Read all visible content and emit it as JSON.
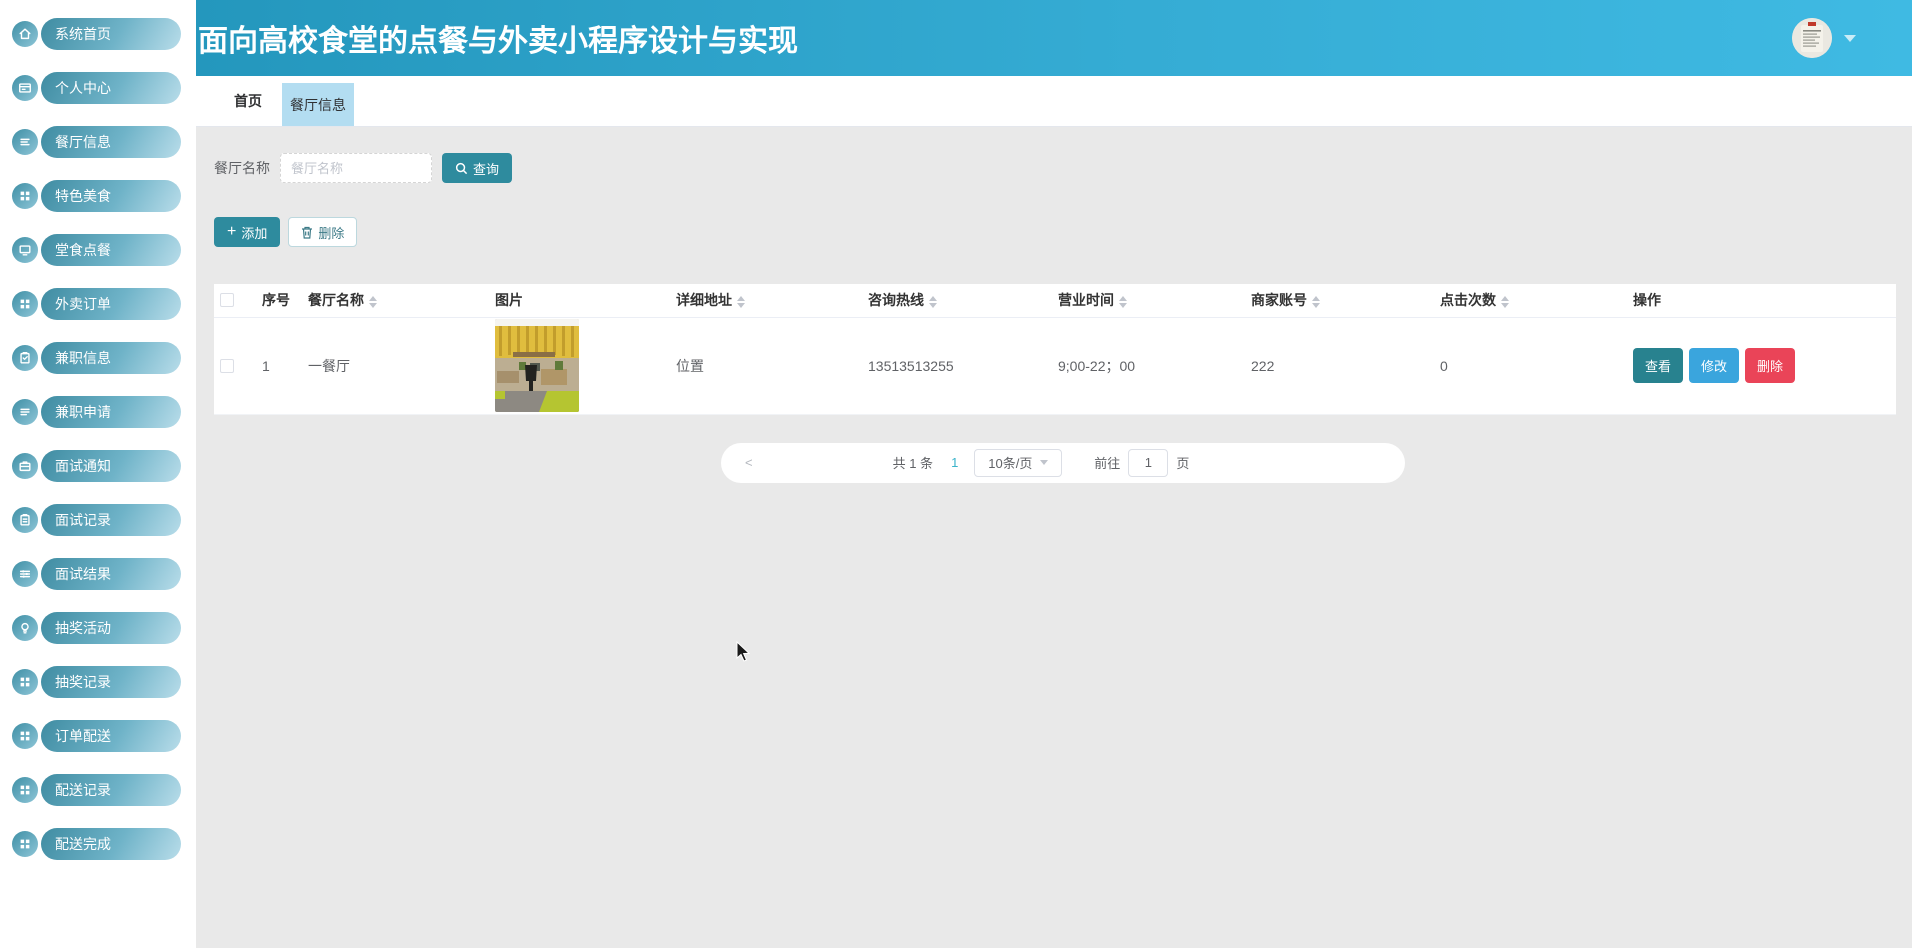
{
  "header": {
    "title": "面向高校食堂的点餐与外卖小程序设计与实现",
    "avatar_icon": "user-avatar-photo",
    "caret_icon": "chevron-down-icon"
  },
  "sidebar": {
    "items": [
      {
        "label": "系统首页",
        "icon": "home-icon"
      },
      {
        "label": "个人中心",
        "icon": "id-card-icon"
      },
      {
        "label": "餐厅信息",
        "icon": "menu-lines-icon"
      },
      {
        "label": "特色美食",
        "icon": "grid-icon"
      },
      {
        "label": "堂食点餐",
        "icon": "monitor-icon"
      },
      {
        "label": "外卖订单",
        "icon": "grid-icon"
      },
      {
        "label": "兼职信息",
        "icon": "clipboard-check-icon"
      },
      {
        "label": "兼职申请",
        "icon": "menu-lines-icon"
      },
      {
        "label": "面试通知",
        "icon": "briefcase-icon"
      },
      {
        "label": "面试记录",
        "icon": "clipboard-icon"
      },
      {
        "label": "面试结果",
        "icon": "sliders-icon"
      },
      {
        "label": "抽奖活动",
        "icon": "lightbulb-icon"
      },
      {
        "label": "抽奖记录",
        "icon": "grid-icon"
      },
      {
        "label": "订单配送",
        "icon": "grid-icon"
      },
      {
        "label": "配送记录",
        "icon": "grid-icon"
      },
      {
        "label": "配送完成",
        "icon": "grid-icon"
      }
    ]
  },
  "tabs": [
    {
      "label": "首页",
      "active": false
    },
    {
      "label": "餐厅信息",
      "active": true
    }
  ],
  "search": {
    "label": "餐厅名称",
    "placeholder": "餐厅名称",
    "button_label": "查询",
    "button_icon": "search-icon"
  },
  "toolbar": {
    "add_label": "添加",
    "delete_label": "删除"
  },
  "table": {
    "columns": [
      {
        "label": "",
        "type": "checkbox",
        "sortable": false
      },
      {
        "label": "序号",
        "sortable": false
      },
      {
        "label": "餐厅名称",
        "sortable": true
      },
      {
        "label": "图片",
        "sortable": false
      },
      {
        "label": "详细地址",
        "sortable": true
      },
      {
        "label": "咨询热线",
        "sortable": true
      },
      {
        "label": "营业时间",
        "sortable": true
      },
      {
        "label": "商家账号",
        "sortable": true
      },
      {
        "label": "点击次数",
        "sortable": true
      },
      {
        "label": "操作",
        "sortable": false
      }
    ],
    "rows": [
      {
        "index": "1",
        "name": "一餐厅",
        "image": "canteen-interior-photo",
        "address": "位置",
        "hotline": "13513513255",
        "hours": "9;00-22；00",
        "account": "222",
        "clicks": "0",
        "actions": [
          "查看",
          "修改",
          "删除"
        ]
      }
    ]
  },
  "pagination": {
    "prev": "<",
    "total": "共 1 条",
    "current_page": "1",
    "page_size": "10条/页",
    "goto_label": "前往",
    "goto_value": "1",
    "goto_suffix": "页"
  },
  "colors": {
    "header_gradient_start": "#2497bd",
    "header_gradient_end": "#3fbae3",
    "sidebar_pill_start": "#3f8ca2",
    "sidebar_pill_end": "#b9ddea",
    "active_tab_bg": "#b3ddf1",
    "primary_teal": "#2e8b9e",
    "view_button": "#28828f",
    "edit_button": "#3aa5dd",
    "delete_button": "#ea4458",
    "current_page_color": "#3ab3ca",
    "content_bg": "#e9e9e9"
  }
}
